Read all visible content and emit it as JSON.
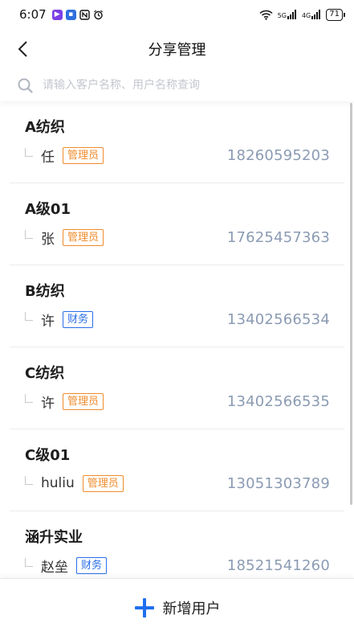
{
  "status_bar": {
    "time": "6:07",
    "network_5g": "5G",
    "network_4g": "4G",
    "battery": "71",
    "colors": {
      "app1": "#7b3fe4",
      "app2": "#2f6fde"
    }
  },
  "nav": {
    "title": "分享管理"
  },
  "search": {
    "placeholder": "请输入客户名称、用户名称查询",
    "value": ""
  },
  "groups": [
    {
      "name": "A纺织",
      "member": "任",
      "role": "管理员",
      "role_type": "admin",
      "phone": "18260595203"
    },
    {
      "name": "A级01",
      "member": "张",
      "role": "管理员",
      "role_type": "admin",
      "phone": "17625457363"
    },
    {
      "name": "B纺织",
      "member": "许",
      "role": "财务",
      "role_type": "finance",
      "phone": "13402566534"
    },
    {
      "name": "C纺织",
      "member": "许",
      "role": "管理员",
      "role_type": "admin",
      "phone": "13402566535"
    },
    {
      "name": "C级01",
      "member": "huliu",
      "role": "管理员",
      "role_type": "admin",
      "phone": "13051303789"
    },
    {
      "name": "涵升实业",
      "member": "赵垒",
      "role": "财务",
      "role_type": "finance",
      "phone": "18521541260"
    }
  ],
  "footer": {
    "add_label": "新增用户",
    "accent": "#1e6ff0"
  },
  "colors": {
    "admin": "#f08c2c",
    "finance": "#2a6ee8",
    "phone": "#8b9bb3"
  }
}
